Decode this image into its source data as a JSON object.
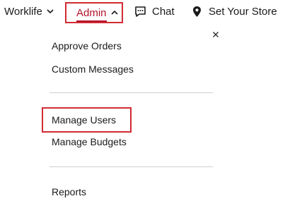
{
  "nav": {
    "worklife_label": "Worklife",
    "admin_label": "Admin",
    "chat_label": "Chat",
    "store_label": "Set Your Store"
  },
  "icons": {
    "worklife_chevron": "chevron-down-icon",
    "admin_chevron": "chevron-up-icon",
    "chat": "chat-icon",
    "store": "location-pin-icon",
    "close": "close-icon"
  },
  "colors": {
    "accent": "#b0142a",
    "highlight_box": "#d12b34",
    "divider": "#cfcfcf"
  },
  "admin_menu": {
    "approve_orders": "Approve Orders",
    "custom_messages": "Custom Messages",
    "manage_users": "Manage Users",
    "manage_budgets": "Manage Budgets",
    "reports": "Reports"
  }
}
